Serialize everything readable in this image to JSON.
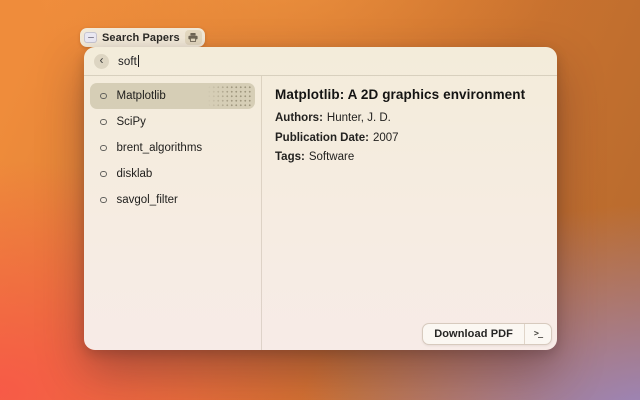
{
  "window_title": {
    "label": "Search Papers",
    "left_icon": "key-dash-icon",
    "right_icon": "printer-icon"
  },
  "search": {
    "back_glyph": "‹",
    "value": "soft"
  },
  "list": {
    "items": [
      {
        "label": "Matplotlib",
        "selected": true,
        "icon": "circle-outline-icon"
      },
      {
        "label": "SciPy",
        "selected": false,
        "icon": "circle-outline-icon"
      },
      {
        "label": "brent_algorithms",
        "selected": false,
        "icon": "circle-outline-icon"
      },
      {
        "label": "disklab",
        "selected": false,
        "icon": "circle-outline-icon"
      },
      {
        "label": "savgol_filter",
        "selected": false,
        "icon": "circle-outline-icon"
      }
    ]
  },
  "detail": {
    "title": "Matplotlib: A 2D graphics environment",
    "fields": [
      {
        "label": "Authors:",
        "value": "Hunter, J. D."
      },
      {
        "label": "Publication Date:",
        "value": "2007"
      },
      {
        "label": "Tags:",
        "value": "Software"
      }
    ]
  },
  "footer": {
    "download_label": "Download PDF",
    "terminal_glyph": ">_"
  },
  "colors": {
    "selection_bg": "#d9d4c1",
    "window_bg_top": "#f3ecda",
    "window_bg_bottom": "#f7ebe7",
    "bg_orange": "#ef8c3b",
    "bg_coral": "#f8584a",
    "bg_brown": "#b4692e",
    "bg_purple": "#9989cd"
  }
}
